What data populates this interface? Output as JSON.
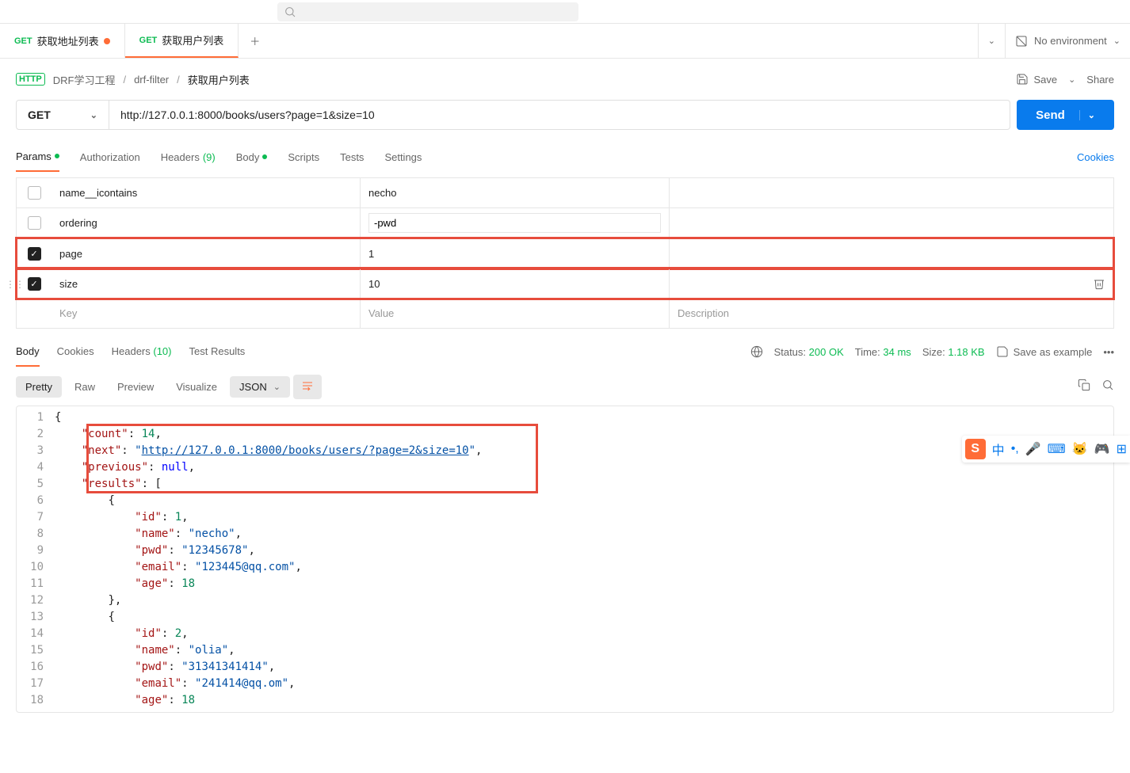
{
  "tabs": [
    {
      "method": "GET",
      "label": "获取地址列表",
      "modified": true
    },
    {
      "method": "GET",
      "label": "获取用户列表",
      "modified": false
    }
  ],
  "env": {
    "label": "No environment"
  },
  "breadcrumb": {
    "workspace": "DRF学习工程",
    "collection": "drf-filter",
    "current": "获取用户列表"
  },
  "actions": {
    "save": "Save",
    "share": "Share"
  },
  "request": {
    "method": "GET",
    "url": "http://127.0.0.1:8000/books/users?page=1&size=10",
    "send": "Send"
  },
  "req_tabs": {
    "params": "Params",
    "authorization": "Authorization",
    "headers": "Headers",
    "headers_count": "(9)",
    "body": "Body",
    "scripts": "Scripts",
    "tests": "Tests",
    "settings": "Settings",
    "cookies": "Cookies"
  },
  "params": [
    {
      "checked": false,
      "key": "name__icontains",
      "value": "necho"
    },
    {
      "checked": false,
      "key": "ordering",
      "value": "-pwd",
      "editing": true
    },
    {
      "checked": true,
      "key": "page",
      "value": "1"
    },
    {
      "checked": true,
      "key": "size",
      "value": "10"
    }
  ],
  "params_placeholder": {
    "key": "Key",
    "value": "Value",
    "desc": "Description"
  },
  "resp_tabs": {
    "body": "Body",
    "cookies": "Cookies",
    "headers": "Headers",
    "headers_count": "(10)",
    "test_results": "Test Results"
  },
  "resp_meta": {
    "status_label": "Status:",
    "status_value": "200 OK",
    "time_label": "Time:",
    "time_value": "34 ms",
    "size_label": "Size:",
    "size_value": "1.18 KB",
    "save_example": "Save as example"
  },
  "body_controls": {
    "pretty": "Pretty",
    "raw": "Raw",
    "preview": "Preview",
    "visualize": "Visualize",
    "format": "JSON"
  },
  "response_json": {
    "count": 14,
    "next": "http://127.0.0.1:8000/books/users/?page=2&size=10",
    "previous": null,
    "results": [
      {
        "id": 1,
        "name": "necho",
        "pwd": "12345678",
        "email": "123445@qq.com",
        "age": 18
      },
      {
        "id": 2,
        "name": "olia",
        "pwd": "31341341414",
        "email": "241414@qq.om",
        "age": 18
      }
    ]
  }
}
